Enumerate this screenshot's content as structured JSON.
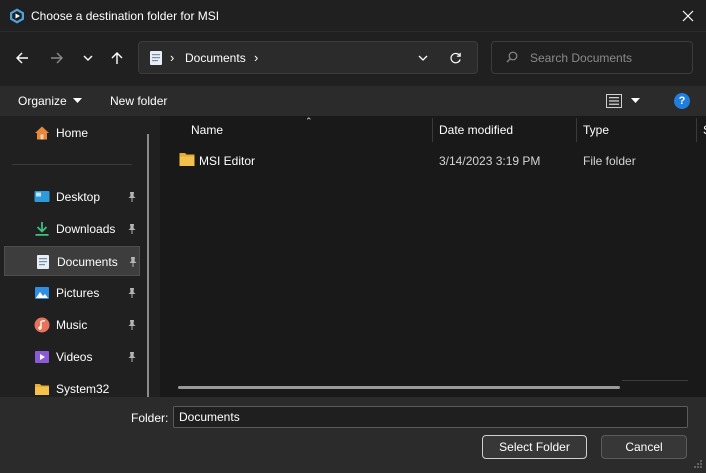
{
  "window": {
    "title": "Choose a destination folder for MSI",
    "app_icon": "msi-app-icon",
    "close_icon": "close-icon"
  },
  "navigation": {
    "back_icon": "arrow-left-icon",
    "forward_icon": "arrow-right-icon",
    "recent_icon": "chevron-down-icon",
    "up_icon": "arrow-up-icon"
  },
  "address_bar": {
    "location_icon": "document-icon",
    "separator": "›",
    "crumbs": [
      "Documents"
    ],
    "dropdown_icon": "chevron-down-icon",
    "refresh_icon": "refresh-icon"
  },
  "search": {
    "placeholder": "Search Documents",
    "value": "",
    "icon": "search-icon"
  },
  "toolbar": {
    "organize_label": "Organize",
    "new_folder_label": "New folder",
    "view_icon": "details-view-icon",
    "help_label": "?"
  },
  "sidebar": {
    "items": [
      {
        "label": "Home",
        "icon": "home-icon",
        "pinned": false
      },
      {
        "label": "Desktop",
        "icon": "desktop-icon",
        "pinned": true
      },
      {
        "label": "Downloads",
        "icon": "download-icon",
        "pinned": true
      },
      {
        "label": "Documents",
        "icon": "document-icon",
        "pinned": true,
        "selected": true
      },
      {
        "label": "Pictures",
        "icon": "pictures-icon",
        "pinned": true
      },
      {
        "label": "Music",
        "icon": "music-icon",
        "pinned": true
      },
      {
        "label": "Videos",
        "icon": "videos-icon",
        "pinned": true
      },
      {
        "label": "System32",
        "icon": "folder-icon",
        "pinned": false
      }
    ]
  },
  "file_list": {
    "columns": [
      "Name",
      "Date modified",
      "Type",
      "S"
    ],
    "rows": [
      {
        "name": "MSI Editor",
        "date_modified": "3/14/2023 3:19 PM",
        "type": "File folder",
        "icon": "folder-icon"
      }
    ]
  },
  "footer": {
    "folder_label": "Folder:",
    "folder_value": "Documents",
    "select_button": "Select Folder",
    "cancel_button": "Cancel"
  },
  "colors": {
    "background": "#202020",
    "panel": "#2b2b2b",
    "list_background": "#191919",
    "accent": "#1f7fe0",
    "folder": "#f2c14e"
  }
}
